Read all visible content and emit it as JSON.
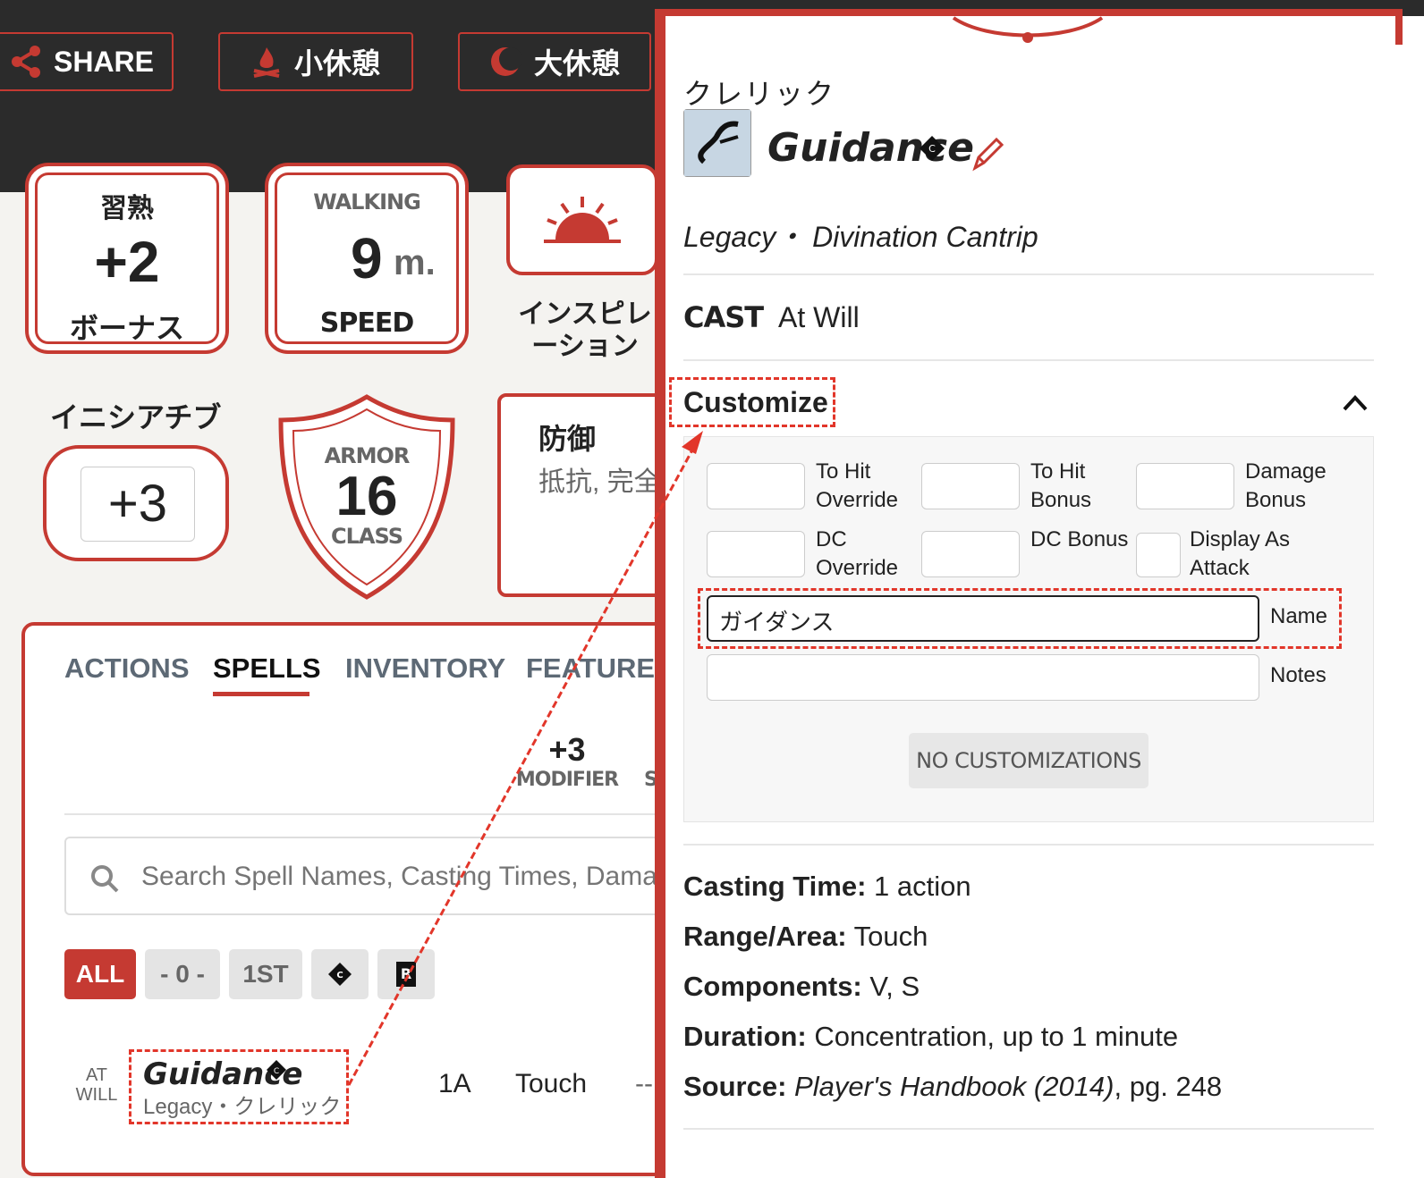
{
  "toolbar": {
    "share": "SHARE",
    "short_rest": "小休憩",
    "long_rest": "大休憩"
  },
  "stats": {
    "proficiency": {
      "top": "習熟",
      "value": "+2",
      "bottom": "ボーナス"
    },
    "speed": {
      "top": "WALKING",
      "value": "9",
      "unit": "m.",
      "bottom": "SPEED"
    },
    "inspiration": {
      "label": "インスピレーション"
    },
    "initiative": {
      "label": "イニシアチブ",
      "value": "+3"
    },
    "armor": {
      "top": "ARMOR",
      "value": "16",
      "bottom": "CLASS"
    },
    "defenses": {
      "title": "防御",
      "text": "抵抗, 完全"
    }
  },
  "tabs": [
    "ACTIONS",
    "SPELLS",
    "INVENTORY",
    "FEATURES"
  ],
  "spell_mod": {
    "value": "+3",
    "label": "MODIFIER",
    "next": "S"
  },
  "search": {
    "placeholder": "Search Spell Names, Casting Times, Damage"
  },
  "filters": [
    "ALL",
    "- 0 -",
    "1ST"
  ],
  "spell_row": {
    "at": "AT",
    "will": "WILL",
    "name": "Guidance",
    "sub": "Legacy・クレリック",
    "time": "1A",
    "range": "Touch",
    "dash": "--"
  },
  "panel": {
    "class_label": "クレリック",
    "spell_name": "Guidance",
    "meta": "Legacy・ Divination Cantrip",
    "cast_label": "CAST",
    "cast_value": "At Will",
    "customize": "Customize",
    "fields": {
      "to_hit_override": "To Hit Override",
      "to_hit_bonus": "To Hit Bonus",
      "damage_bonus": "Damage Bonus",
      "dc_override": "DC Override",
      "dc_bonus": "DC Bonus",
      "display_as_attack": "Display As Attack",
      "name_label": "Name",
      "name_value": "ガイダンス",
      "notes_label": "Notes"
    },
    "no_custom": "NO CUSTOMIZATIONS",
    "props": [
      {
        "k": "Casting Time:",
        "v": "1 action"
      },
      {
        "k": "Range/Area:",
        "v": "Touch"
      },
      {
        "k": "Components:",
        "v": "V, S"
      },
      {
        "k": "Duration:",
        "v": "Concentration, up to 1 minute"
      }
    ],
    "source_label": "Source:",
    "source_book": "Player's Handbook (2014)",
    "source_page": ", pg. 248"
  },
  "colors": {
    "accent": "#c53a32",
    "annotation": "#e2362a"
  }
}
